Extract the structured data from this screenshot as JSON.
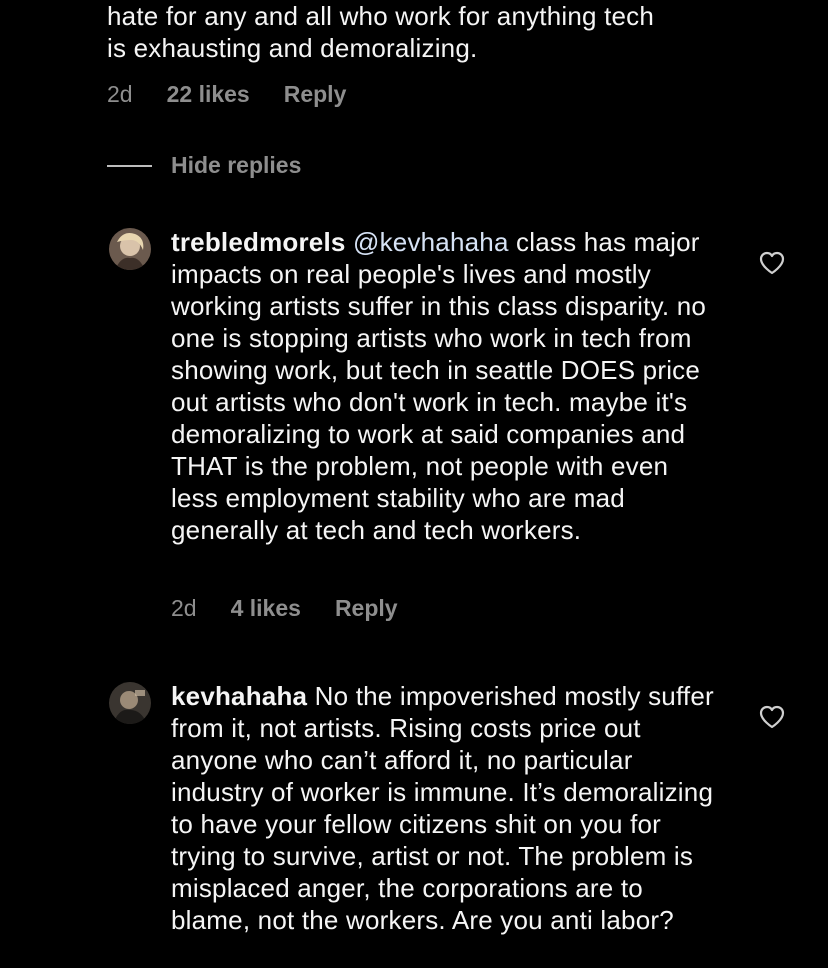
{
  "top_comment": {
    "text_line1": "hate for any and all who work for anything tech",
    "text_line2": "is exhausting and demoralizing.",
    "time": "2d",
    "likes": "22 likes",
    "reply": "Reply"
  },
  "hide_replies": "Hide replies",
  "replies": [
    {
      "username": "trebledmorels",
      "mention": "@kevhahaha",
      "text": "class has major impacts on real people's lives and mostly working artists suffer in this class disparity. no one is stopping artists who work in tech from showing work, but tech in seattle DOES price out artists who don't work in tech. maybe it's demoralizing to work at said companies and THAT is the problem, not people with even less employment stability who are mad generally at tech and tech workers.",
      "time": "2d",
      "likes": "4 likes",
      "reply": "Reply"
    },
    {
      "username": "kevhahaha",
      "text": "No the impoverished mostly suffer from it, not artists. Rising costs price out anyone who can’t afford it, no particular industry of worker is immune. It’s demoralizing to have your fellow citizens shit on you for trying to survive, artist or not. The problem is misplaced anger, the corporations are to blame, not the workers. Are you anti labor?"
    }
  ],
  "icons": {
    "like": "heart-outline-icon",
    "avatar1": "avatar",
    "avatar2": "avatar"
  },
  "colors": {
    "background": "#000000",
    "text": "#f5f5f5",
    "secondary": "#8e8e8e",
    "mention": "#d6e2f5"
  }
}
